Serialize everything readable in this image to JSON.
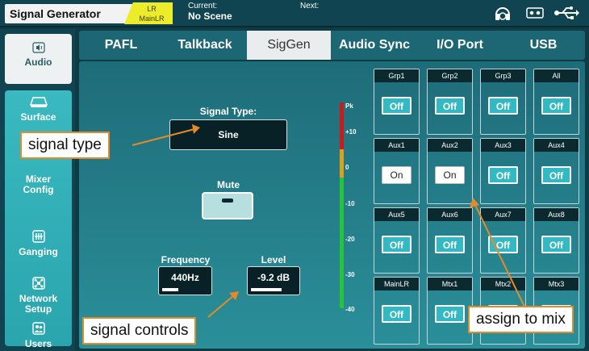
{
  "header": {
    "app_title": "Signal Generator",
    "badge_line1": "LR",
    "badge_line2": "MainLR",
    "current_label": "Current:",
    "current_value": "No Scene",
    "next_label": "Next:",
    "icons": [
      "headphones-icon",
      "cassette-icon",
      "usb-icon"
    ]
  },
  "sidebar": {
    "items": [
      {
        "label": "Audio",
        "icon": "speaker-icon",
        "active": true
      },
      {
        "label": "Surface",
        "icon": "surface-icon"
      },
      {
        "label": "Mixer Config",
        "icon": "mixer-config-icon"
      },
      {
        "label": "Ganging",
        "icon": "ganging-icon"
      },
      {
        "label": "Network Setup",
        "icon": "network-icon"
      },
      {
        "label": "Users",
        "icon": "users-icon"
      }
    ],
    "mixer_line1": "Mixer",
    "mixer_line2": "Config",
    "network_line1": "Network",
    "network_line2": "Setup"
  },
  "tabs": [
    {
      "label": "PAFL"
    },
    {
      "label": "Talkback"
    },
    {
      "label": "SigGen",
      "active": true
    },
    {
      "label": "Audio Sync"
    },
    {
      "label": "I/O Port"
    },
    {
      "label": "USB"
    }
  ],
  "siggen": {
    "signal_type_label": "Signal Type:",
    "signal_type_value": "Sine",
    "mute_label": "Mute",
    "frequency_label": "Frequency",
    "frequency_value": "440Hz",
    "frequency_fraction": 0.35,
    "level_label": "Level",
    "level_value": "-9.2 dB",
    "level_fraction": 0.68
  },
  "meter": {
    "ticks": [
      "Pk",
      "+10",
      "0",
      "-10",
      "-20",
      "-30",
      "-40"
    ],
    "colors": {
      "red": "#cc1a1a",
      "orange": "#d9a21b",
      "green": "#27c33a"
    }
  },
  "mix_assign": [
    {
      "name": "Grp1",
      "state": "Off"
    },
    {
      "name": "Grp2",
      "state": "Off"
    },
    {
      "name": "Grp3",
      "state": "Off"
    },
    {
      "name": "All",
      "state": "Off"
    },
    {
      "name": "Aux1",
      "state": "On"
    },
    {
      "name": "Aux2",
      "state": "On"
    },
    {
      "name": "Aux3",
      "state": "Off"
    },
    {
      "name": "Aux4",
      "state": "Off"
    },
    {
      "name": "Aux5",
      "state": "Off"
    },
    {
      "name": "Aux6",
      "state": "Off"
    },
    {
      "name": "Aux7",
      "state": "Off"
    },
    {
      "name": "Aux8",
      "state": "Off"
    },
    {
      "name": "MainLR",
      "state": "Off"
    },
    {
      "name": "Mtx1",
      "state": "Off"
    },
    {
      "name": "Mtx2",
      "state": "Off"
    },
    {
      "name": "Mtx3",
      "state": "Off"
    }
  ],
  "annotations": {
    "signal_type": "signal type",
    "signal_controls": "signal controls",
    "assign_to_mix": "assign to mix",
    "color": "#e58a2a"
  }
}
